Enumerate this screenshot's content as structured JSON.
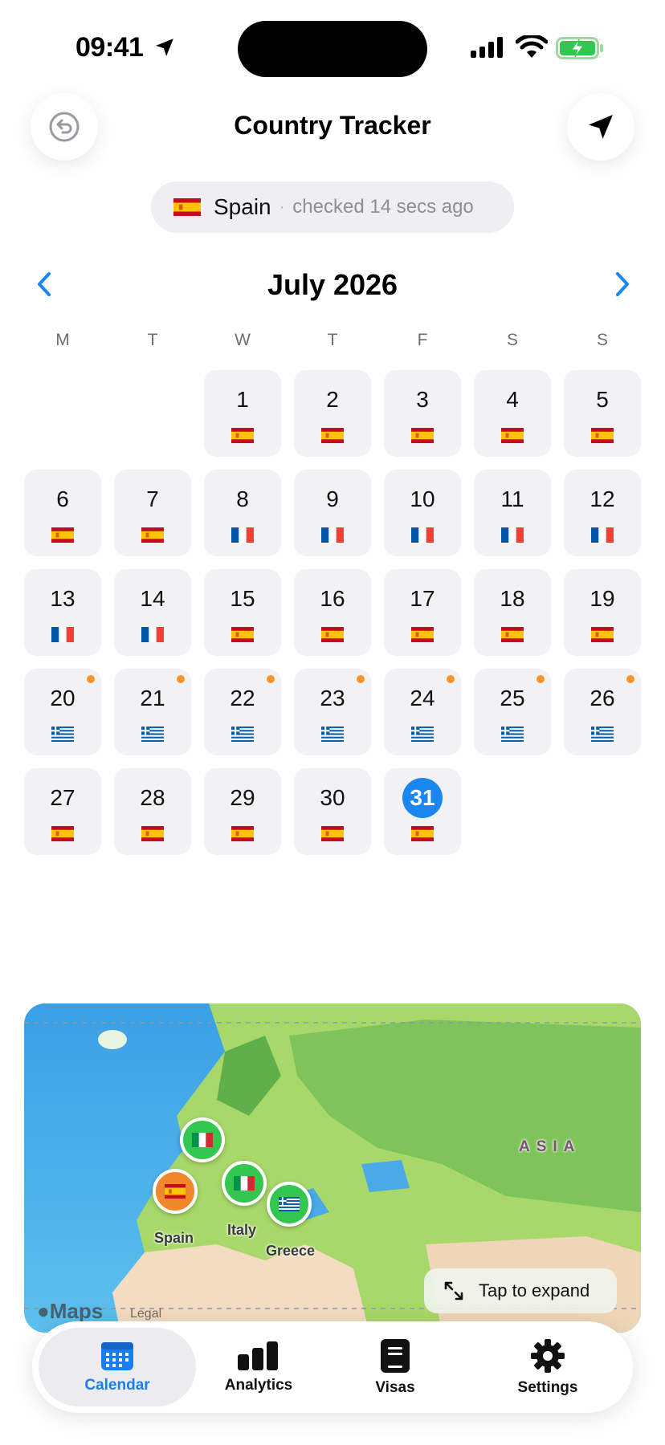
{
  "status_bar": {
    "time": "09:41"
  },
  "header": {
    "title": "Country Tracker",
    "back_icon": "undo-circle-icon",
    "locate_icon": "location-arrow-icon"
  },
  "current": {
    "country": "Spain",
    "flag": "spain",
    "checked": "checked 14 secs ago",
    "separator": "·"
  },
  "calendar": {
    "month_title": "July 2026",
    "weekdays": [
      "M",
      "T",
      "W",
      "T",
      "F",
      "S",
      "S"
    ],
    "leading_blanks": 2,
    "days": [
      {
        "d": "1",
        "flag": "spain"
      },
      {
        "d": "2",
        "flag": "spain"
      },
      {
        "d": "3",
        "flag": "spain"
      },
      {
        "d": "4",
        "flag": "spain"
      },
      {
        "d": "5",
        "flag": "spain"
      },
      {
        "d": "6",
        "flag": "spain"
      },
      {
        "d": "7",
        "flag": "spain"
      },
      {
        "d": "8",
        "flag": "france"
      },
      {
        "d": "9",
        "flag": "france"
      },
      {
        "d": "10",
        "flag": "france"
      },
      {
        "d": "11",
        "flag": "france"
      },
      {
        "d": "12",
        "flag": "france"
      },
      {
        "d": "13",
        "flag": "france"
      },
      {
        "d": "14",
        "flag": "france"
      },
      {
        "d": "15",
        "flag": "spain"
      },
      {
        "d": "16",
        "flag": "spain"
      },
      {
        "d": "17",
        "flag": "spain"
      },
      {
        "d": "18",
        "flag": "spain"
      },
      {
        "d": "19",
        "flag": "spain"
      },
      {
        "d": "20",
        "flag": "greece",
        "dot": true
      },
      {
        "d": "21",
        "flag": "greece",
        "dot": true
      },
      {
        "d": "22",
        "flag": "greece",
        "dot": true
      },
      {
        "d": "23",
        "flag": "greece",
        "dot": true
      },
      {
        "d": "24",
        "flag": "greece",
        "dot": true
      },
      {
        "d": "25",
        "flag": "greece",
        "dot": true
      },
      {
        "d": "26",
        "flag": "greece",
        "dot": true
      },
      {
        "d": "27",
        "flag": "spain"
      },
      {
        "d": "28",
        "flag": "spain"
      },
      {
        "d": "29",
        "flag": "spain"
      },
      {
        "d": "30",
        "flag": "spain"
      },
      {
        "d": "31",
        "flag": "spain",
        "today": true
      }
    ]
  },
  "map": {
    "region_label": "ASIA",
    "pins": [
      {
        "flag": "italy",
        "color": "green",
        "label": ""
      },
      {
        "flag": "spain",
        "color": "orange",
        "label": "Spain"
      },
      {
        "flag": "italy",
        "color": "green",
        "label": "Italy"
      },
      {
        "flag": "greece",
        "color": "green",
        "label": "Greece"
      }
    ],
    "maps_logo": "Maps",
    "legal": "Legal",
    "expand_label": "Tap to expand"
  },
  "tabs": [
    {
      "label": "Calendar",
      "icon": "calendar-icon",
      "active": true
    },
    {
      "label": "Analytics",
      "icon": "bar-chart-icon",
      "active": false
    },
    {
      "label": "Visas",
      "icon": "passport-icon",
      "active": false
    },
    {
      "label": "Settings",
      "icon": "gear-icon",
      "active": false
    }
  ],
  "colors": {
    "accent": "#1a87f0",
    "pin_green": "#34c74f",
    "pin_orange": "#f0882a",
    "event_dot": "#ff9230",
    "cell_bg": "#f2f2f5"
  }
}
